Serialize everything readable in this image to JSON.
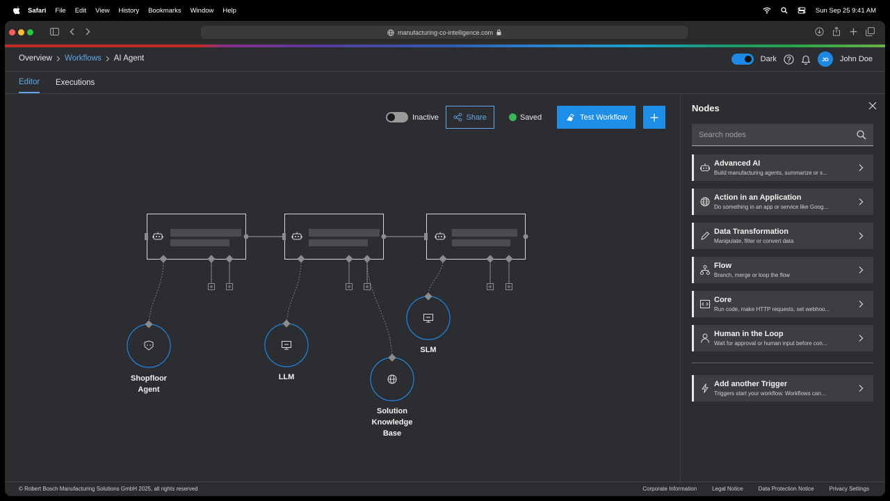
{
  "menubar": {
    "app": "Safari",
    "items": [
      "File",
      "Edit",
      "View",
      "History",
      "Bookmarks",
      "Window",
      "Help"
    ],
    "clock": "Sun Sep 25  9:41 AM"
  },
  "browser": {
    "url": "manufacturing-co-intelligence.com"
  },
  "breadcrumb": {
    "item1": "Overview",
    "item2": "Workflows",
    "item3": "AI Agent"
  },
  "header": {
    "theme_label": "Dark",
    "user_initials": "JD",
    "user_name": "John Doe"
  },
  "tabs": {
    "editor": "Editor",
    "executions": "Executions"
  },
  "toolbar": {
    "status_label": "Inactive",
    "share_label": "Share",
    "saved_label": "Saved",
    "test_label": "Test Workflow"
  },
  "canvas": {
    "labels": {
      "shopfloor_line1": "Shopfloor",
      "shopfloor_line2": "Agent",
      "llm": "LLM",
      "slm": "SLM",
      "skb_line1": "Solution",
      "skb_line2": "Knowledge",
      "skb_line3": "Base"
    }
  },
  "panel": {
    "title": "Nodes",
    "search_placeholder": "Search nodes",
    "items": [
      {
        "title": "Advanced AI",
        "desc": "Build manufacturing agents, summarize or s...",
        "icon": "robot-icon"
      },
      {
        "title": "Action in an Application",
        "desc": "Do something in an app or service like Goog...",
        "icon": "globe-icon"
      },
      {
        "title": "Data Transformation",
        "desc": "Manipulate, filter or convert data",
        "icon": "pen-icon"
      },
      {
        "title": "Flow",
        "desc": "Branch, merge or loop the flow",
        "icon": "hierarchy-icon"
      },
      {
        "title": "Core",
        "desc": "Run code, make HTTP requests, set webhoo...",
        "icon": "code-icon"
      },
      {
        "title": "Human in the Loop",
        "desc": "Wait for approval or human input before con...",
        "icon": "person-icon"
      }
    ],
    "trigger": {
      "title": "Add another Trigger",
      "desc": "Triggers start your workflow. Workflows can...",
      "icon": "lightning-icon"
    }
  },
  "footer": {
    "copyright": "© Robert Bosch Manufacturing Solutions GmbH 2025, all rights reserved",
    "links": [
      "Corporate Information",
      "Legal Notice",
      "Data Protection Notice",
      "Privacy Settings"
    ]
  }
}
